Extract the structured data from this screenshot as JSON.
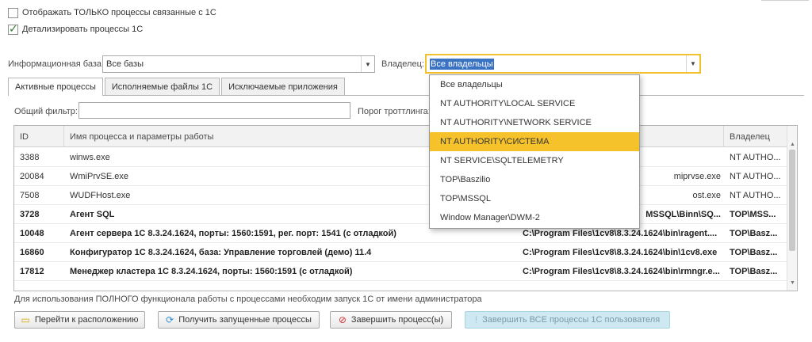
{
  "filters": {
    "only_1c_label": "Отображать ТОЛЬКО процессы связанные с 1С",
    "only_1c_checked": false,
    "detail_label": "Детализировать процессы 1С",
    "detail_checked": true
  },
  "infobase": {
    "label": "Информационная база:",
    "value": "Все базы"
  },
  "owner": {
    "label": "Владелец:",
    "value": "Все владельцы"
  },
  "tabs": [
    "Активные процессы",
    "Исполняемые файлы 1С",
    "Исключаемые приложения"
  ],
  "general_filter": {
    "label": "Общий фильтр:",
    "value": ""
  },
  "throttling": {
    "label": "Порог троттлинга:"
  },
  "table": {
    "columns": [
      "ID",
      "Имя процесса и параметры работы",
      "",
      "Владелец"
    ],
    "rows": [
      {
        "id": "3388",
        "name": "winws.exe",
        "path": "",
        "owner": "NT AUTHO...",
        "bold": false
      },
      {
        "id": "20084",
        "name": "WmiPrvSE.exe",
        "path": "miprvse.exe",
        "owner": "NT AUTHO...",
        "bold": false
      },
      {
        "id": "7508",
        "name": "WUDFHost.exe",
        "path": "ost.exe",
        "owner": "NT AUTHO...",
        "bold": false
      },
      {
        "id": "3728",
        "name": "Агент SQL",
        "path": "MSSQL\\Binn\\SQ...",
        "owner": "TOP\\MSS...",
        "bold": true
      },
      {
        "id": "10048",
        "name": "Агент сервера 1С 8.3.24.1624, порты: 1560:1591, рег. порт: 1541 (с отладкой)",
        "path": "C:\\Program Files\\1cv8\\8.3.24.1624\\bin\\ragent....",
        "owner": "TOP\\Basz...",
        "bold": true
      },
      {
        "id": "16860",
        "name": "Конфигуратор 1С 8.3.24.1624, база: Управление торговлей (демо) 11.4",
        "path": "C:\\Program Files\\1cv8\\8.3.24.1624\\bin\\1cv8.exe",
        "owner": "TOP\\Basz...",
        "bold": true
      },
      {
        "id": "17812",
        "name": "Менеджер кластера 1С 8.3.24.1624, порты: 1560:1591 (с отладкой)",
        "path": "C:\\Program Files\\1cv8\\8.3.24.1624\\bin\\rmngr.e...",
        "owner": "TOP\\Basz...",
        "bold": true
      }
    ]
  },
  "hint": "Для использования ПОЛНОГО функционала работы с процессами необходим запуск 1С от имени администратора",
  "buttons": {
    "goto": "Перейти к расположению",
    "refresh": "Получить запущенные процессы",
    "terminate": "Завершить процесс(ы)",
    "terminate_all": "Завершить ВСЕ процессы 1С пользователя"
  },
  "owner_dropdown": {
    "items": [
      "Все владельцы",
      "NT AUTHORITY\\LOCAL SERVICE",
      "NT AUTHORITY\\NETWORK SERVICE",
      "NT AUTHORITY\\СИСТЕМА",
      "NT SERVICE\\SQLTELEMETRY",
      "TOP\\Baszilio",
      "TOP\\MSSQL",
      "Window Manager\\DWM-2"
    ],
    "highlighted_index": 3
  },
  "colors": {
    "highlight": "#f6c22b",
    "selection": "#3a72c4",
    "checkmark": "#2e7d32",
    "disabled_button": "#cfe9f2"
  }
}
